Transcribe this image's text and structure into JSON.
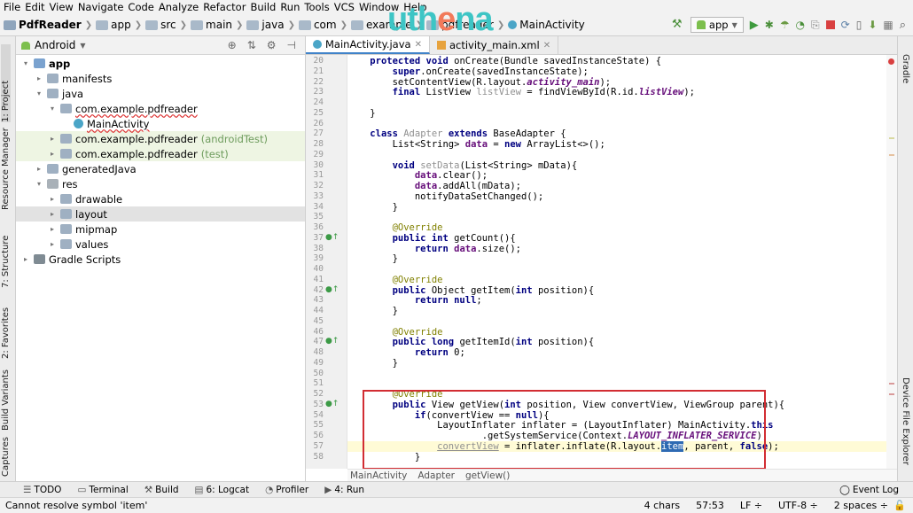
{
  "menu": [
    "File",
    "Edit",
    "View",
    "Navigate",
    "Code",
    "Analyze",
    "Refactor",
    "Build",
    "Run",
    "Tools",
    "VCS",
    "Window",
    "Help"
  ],
  "nav": {
    "crumbs": [
      "PdfReader",
      "app",
      "src",
      "main",
      "java",
      "com",
      "example",
      "pdfreader",
      "MainActivity"
    ],
    "logo_a": "uth",
    "logo_b": "e",
    "logo_c": "na",
    "run_config": "app"
  },
  "left_tabs": [
    "1: Project",
    "Resource Manager",
    "7: Structure",
    "2: Favorites",
    "Build Variants",
    "Captures"
  ],
  "right_tabs": [
    "Gradle",
    "Device File Explorer"
  ],
  "project": {
    "view": "Android",
    "tree": [
      {
        "label": "app",
        "indent": 0,
        "icon": "folder-blue",
        "arrow": "▾",
        "bold": true
      },
      {
        "label": "manifests",
        "indent": 1,
        "icon": "folder",
        "arrow": "▸"
      },
      {
        "label": "java",
        "indent": 1,
        "icon": "folder",
        "arrow": "▾"
      },
      {
        "label": "com.example.pdfreader",
        "indent": 2,
        "icon": "folder",
        "arrow": "▾",
        "red": true
      },
      {
        "label": "MainActivity",
        "indent": 3,
        "icon": "class",
        "arrow": "",
        "red": true
      },
      {
        "label": "com.example.pdfreader",
        "suffix": "(androidTest)",
        "indent": 2,
        "icon": "folder",
        "arrow": "▸",
        "hl": "green"
      },
      {
        "label": "com.example.pdfreader",
        "suffix": "(test)",
        "indent": 2,
        "icon": "folder",
        "arrow": "▸",
        "hl": "green"
      },
      {
        "label": "generatedJava",
        "indent": 1,
        "icon": "folder",
        "arrow": "▸"
      },
      {
        "label": "res",
        "indent": 1,
        "icon": "res",
        "arrow": "▾"
      },
      {
        "label": "drawable",
        "indent": 2,
        "icon": "folder",
        "arrow": "▸"
      },
      {
        "label": "layout",
        "indent": 2,
        "icon": "folder",
        "arrow": "▸",
        "hl": "gray"
      },
      {
        "label": "mipmap",
        "indent": 2,
        "icon": "folder",
        "arrow": "▸"
      },
      {
        "label": "values",
        "indent": 2,
        "icon": "folder",
        "arrow": "▸"
      },
      {
        "label": "Gradle Scripts",
        "indent": 0,
        "icon": "gradle",
        "arrow": "▸"
      }
    ]
  },
  "editor": {
    "tabs": [
      {
        "label": "MainActivity.java",
        "active": true
      },
      {
        "label": "activity_main.xml",
        "active": false
      }
    ],
    "lines": [
      {
        "n": "20",
        "html": "    <span class=\"kw\">protected void</span> onCreate(Bundle savedInstanceState) {"
      },
      {
        "n": "21",
        "html": "        <span class=\"kw\">super</span>.onCreate(savedInstanceState);"
      },
      {
        "n": "22",
        "html": "        setContentView(R.layout.<span class=\"fd\">activity_main</span>);"
      },
      {
        "n": "23",
        "html": "        <span class=\"kw\">final</span> ListView <span class=\"gy\">listView</span> = findViewById(R.id.<span class=\"fd\">listView</span>);"
      },
      {
        "n": "24",
        "html": ""
      },
      {
        "n": "25",
        "html": "    }"
      },
      {
        "n": "26",
        "html": ""
      },
      {
        "n": "27",
        "html": "    <span class=\"kw\">class</span> <span class=\"gy\">Adapter</span> <span class=\"kw\">extends</span> BaseAdapter {"
      },
      {
        "n": "28",
        "html": "        List&lt;String&gt; <span class=\"fd2\">data</span> = <span class=\"kw\">new</span> ArrayList&lt;&gt;();"
      },
      {
        "n": "29",
        "html": ""
      },
      {
        "n": "30",
        "html": "        <span class=\"kw\">void</span> <span class=\"gy\">setData</span>(List&lt;String&gt; mData){"
      },
      {
        "n": "31",
        "html": "            <span class=\"fd2\">data</span>.clear();"
      },
      {
        "n": "32",
        "html": "            <span class=\"fd2\">data</span>.addAll(mData);"
      },
      {
        "n": "33",
        "html": "            notifyDataSetChanged();"
      },
      {
        "n": "34",
        "html": "        }"
      },
      {
        "n": "35",
        "html": ""
      },
      {
        "n": "36",
        "html": "        <span class=\"an\">@Override</span>"
      },
      {
        "n": "37",
        "html": "        <span class=\"kw\">public int</span> getCount(){",
        "mark": true
      },
      {
        "n": "38",
        "html": "            <span class=\"kw\">return</span> <span class=\"fd2\">data</span>.size();"
      },
      {
        "n": "39",
        "html": "        }"
      },
      {
        "n": "40",
        "html": ""
      },
      {
        "n": "41",
        "html": "        <span class=\"an\">@Override</span>"
      },
      {
        "n": "42",
        "html": "        <span class=\"kw\">public</span> Object getItem(<span class=\"kw\">int</span> position){",
        "mark": true
      },
      {
        "n": "43",
        "html": "            <span class=\"kw\">return null</span>;"
      },
      {
        "n": "44",
        "html": "        }"
      },
      {
        "n": "45",
        "html": ""
      },
      {
        "n": "46",
        "html": "        <span class=\"an\">@Override</span>"
      },
      {
        "n": "47",
        "html": "        <span class=\"kw\">public long</span> getItemId(<span class=\"kw\">int</span> position){",
        "mark": true
      },
      {
        "n": "48",
        "html": "            <span class=\"kw\">return</span> 0;"
      },
      {
        "n": "49",
        "html": "        }"
      },
      {
        "n": "50",
        "html": ""
      },
      {
        "n": "51",
        "html": ""
      },
      {
        "n": "52",
        "html": "        <span class=\"an\">@Override</span>"
      },
      {
        "n": "53",
        "html": "        <span class=\"kw\">public</span> View getView(<span class=\"kw\">int</span> position, View convertView, ViewGroup parent){",
        "mark": true
      },
      {
        "n": "54",
        "html": "            <span class=\"kw\">if</span>(convertView == <span class=\"kw\">null</span>){"
      },
      {
        "n": "55",
        "html": "                LayoutInflater inflater = (LayoutInflater) MainActivity.<span class=\"kw\">this</span>"
      },
      {
        "n": "56",
        "html": "                        .getSystemService(Context.<span class=\"fd\">LAYOUT_INFLATER_SERVICE</span>);"
      },
      {
        "n": "57",
        "html": "                <span class=\"gy\" style=\"text-decoration:underline\">convertView</span> = inflater.inflate(R.layout.<span class=\"sel\">item</span>, parent, <span class=\"kw\">false</span>);",
        "current": true
      },
      {
        "n": "58",
        "html": "            }"
      }
    ],
    "breadcrumb": [
      "MainActivity",
      "Adapter",
      "getView()"
    ]
  },
  "bottom_tools": [
    "TODO",
    "Terminal",
    "Build",
    "6: Logcat",
    "Profiler",
    "4: Run"
  ],
  "event_log": "Event Log",
  "status": {
    "message": "Cannot resolve symbol 'item'",
    "chars": "4 chars",
    "position": "57:53",
    "line_sep": "LF ÷",
    "encoding": "UTF-8 ÷",
    "indent": "2 spaces ÷"
  }
}
